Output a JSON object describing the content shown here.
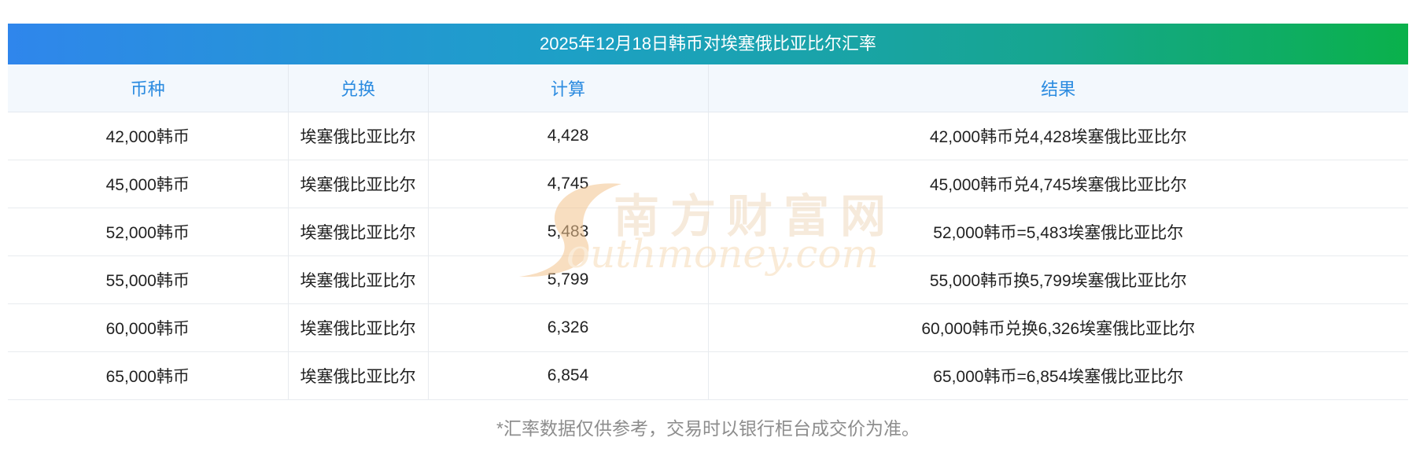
{
  "title": "2025年12月18日韩币对埃塞俄比亚比尔汇率",
  "table": {
    "headers": [
      "币种",
      "兑换",
      "计算",
      "结果"
    ],
    "rows": [
      [
        "42,000韩币",
        "埃塞俄比亚比尔",
        "4,428",
        "42,000韩币兑4,428埃塞俄比亚比尔"
      ],
      [
        "45,000韩币",
        "埃塞俄比亚比尔",
        "4,745",
        "45,000韩币兑4,745埃塞俄比亚比尔"
      ],
      [
        "52,000韩币",
        "埃塞俄比亚比尔",
        "5,483",
        "52,000韩币=5,483埃塞俄比亚比尔"
      ],
      [
        "55,000韩币",
        "埃塞俄比亚比尔",
        "5,799",
        "55,000韩币换5,799埃塞俄比亚比尔"
      ],
      [
        "60,000韩币",
        "埃塞俄比亚比尔",
        "6,326",
        "60,000韩币兑换6,326埃塞俄比亚比尔"
      ],
      [
        "65,000韩币",
        "埃塞俄比亚比尔",
        "6,854",
        "65,000韩币=6,854埃塞俄比亚比尔"
      ]
    ]
  },
  "watermark": {
    "cn": "南方财富网",
    "en": "outhmoney.com"
  },
  "footnote": "*汇率数据仅供参考，交易时以银行柜台成交价为准。",
  "colors": {
    "title_gradient_start": "#2f86ec",
    "title_gradient_end": "#0ab14b",
    "header_text": "#2b8be0",
    "header_bg": "#f3f8fd",
    "footnote_text": "#8d8d8d"
  }
}
